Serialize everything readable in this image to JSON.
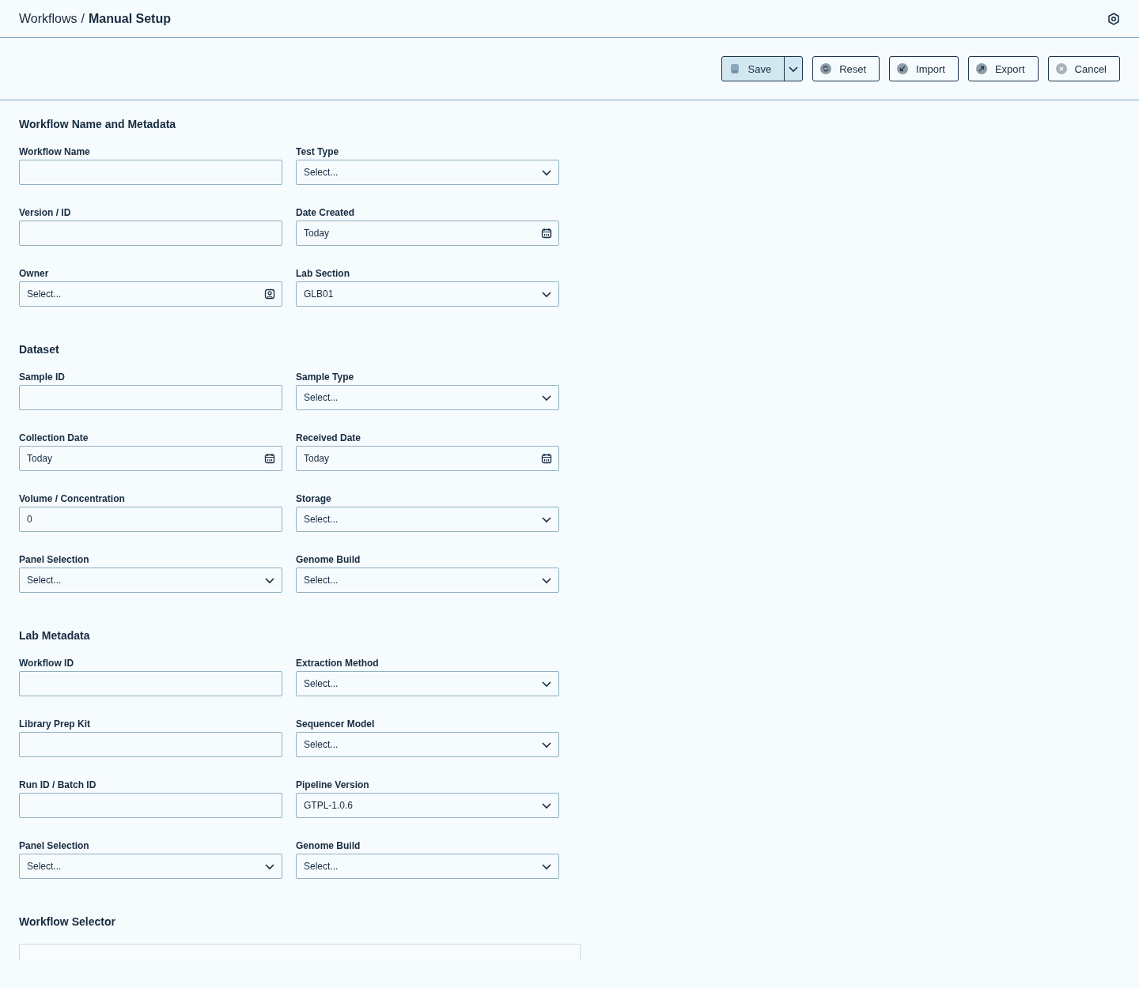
{
  "breadcrumb": {
    "parent": "Workflows",
    "separator": "/",
    "current": "Manual Setup"
  },
  "toolbar": {
    "buttons": [
      {
        "label": "Save",
        "kind": "save"
      },
      {
        "label": "Reset",
        "kind": "reset"
      },
      {
        "label": "Import",
        "kind": "import"
      },
      {
        "label": "Export",
        "kind": "export"
      },
      {
        "label": "Cancel",
        "kind": "cancel"
      }
    ]
  },
  "sections": [
    {
      "title": "Workflow Name and Metadata",
      "fields": [
        {
          "label": "Workflow Name",
          "kind": "text"
        },
        {
          "label": "Test Type",
          "kind": "select",
          "placeholder": "Select..."
        },
        {
          "label": "Version / ID",
          "kind": "text"
        },
        {
          "label": "Date Created",
          "kind": "date",
          "value": "Today"
        },
        {
          "label": "Owner",
          "kind": "person",
          "placeholder": "Select..."
        },
        {
          "label": "Lab Section",
          "kind": "select",
          "value": "GLB01"
        }
      ]
    },
    {
      "title": "Dataset",
      "fields": [
        {
          "label": "Sample ID",
          "kind": "text"
        },
        {
          "label": "Sample Type",
          "kind": "select",
          "placeholder": "Select..."
        },
        {
          "label": "Collection Date",
          "kind": "date",
          "value": "Today"
        },
        {
          "label": "Received Date",
          "kind": "date",
          "value": "Today"
        },
        {
          "label": "Volume / Concentration",
          "kind": "text",
          "value": "0"
        },
        {
          "label": "Storage",
          "kind": "select",
          "placeholder": "Select..."
        },
        {
          "label": "Panel Selection",
          "kind": "select",
          "placeholder": "Select..."
        },
        {
          "label": "Genome Build",
          "kind": "select",
          "placeholder": "Select..."
        }
      ]
    },
    {
      "title": "Lab Metadata",
      "fields": [
        {
          "label": "Workflow ID",
          "kind": "text"
        },
        {
          "label": "Extraction Method",
          "kind": "select",
          "placeholder": "Select..."
        },
        {
          "label": "Library Prep Kit",
          "kind": "text"
        },
        {
          "label": "Sequencer Model",
          "kind": "select",
          "placeholder": "Select..."
        },
        {
          "label": "Run ID / Batch ID",
          "kind": "text"
        },
        {
          "label": "Pipeline Version",
          "kind": "select",
          "value": "GTPL-1.0.6"
        },
        {
          "label": "Panel Selection",
          "kind": "select",
          "placeholder": "Select..."
        },
        {
          "label": "Genome Build",
          "kind": "select",
          "placeholder": "Select..."
        }
      ]
    }
  ],
  "workflow_selector": {
    "title": "Workflow Selector"
  }
}
